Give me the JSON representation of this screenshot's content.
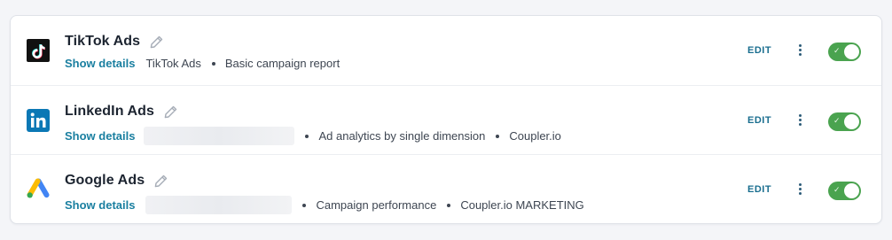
{
  "integrations": [
    {
      "title": "TikTok Ads",
      "logo": "tiktok-logo",
      "show_details": "Show details",
      "source": "TikTok Ads",
      "report": "Basic campaign report",
      "extra": "",
      "edit": "EDIT",
      "enabled": true
    },
    {
      "title": "LinkedIn Ads",
      "logo": "linkedin-logo",
      "show_details": "Show details",
      "source": "",
      "report": "Ad analytics by single dimension",
      "extra": "Coupler.io",
      "edit": "EDIT",
      "enabled": true
    },
    {
      "title": "Google Ads",
      "logo": "google-ads-logo",
      "show_details": "Show details",
      "source": "",
      "report": "Campaign performance",
      "extra": "Coupler.io MARKETING",
      "edit": "EDIT",
      "enabled": true
    }
  ],
  "toggle_check_glyph": "✓",
  "colors": {
    "accent_link": "#1a7fa0",
    "toggle_on": "#4aa34f",
    "title": "#1c2430"
  }
}
